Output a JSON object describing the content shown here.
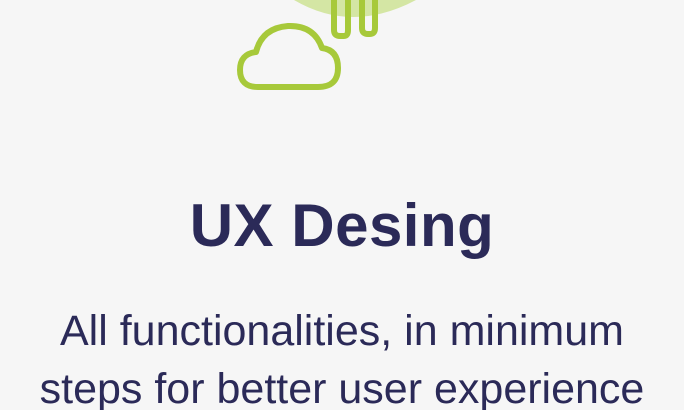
{
  "feature": {
    "title": "UX Desing",
    "description_lines": [
      "All functionalities, in minimum",
      "steps for better user experience"
    ],
    "icons": [
      "plant-icon",
      "cloud-icon"
    ],
    "colors": {
      "accent": "#a7c93a",
      "accent_light": "#d4e6a4",
      "text": "#2b2a58",
      "background": "#f6f6f6"
    }
  }
}
